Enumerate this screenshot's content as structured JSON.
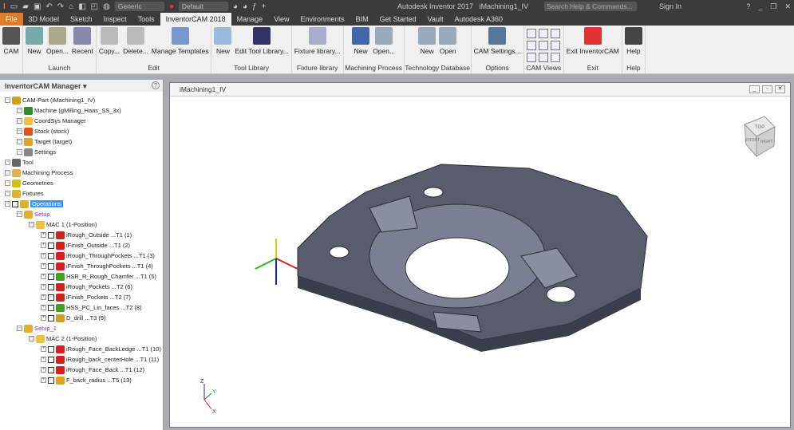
{
  "titlebar": {
    "app_title": "Autodesk Inventor 2017",
    "doc_title": "iMachining1_IV",
    "material": "Generic",
    "appearance": "Default",
    "search_placeholder": "Search Help & Commands...",
    "sign_in": "Sign In"
  },
  "tabs": [
    "File",
    "3D Model",
    "Sketch",
    "Inspect",
    "Tools",
    "InventorCAM 2018",
    "Manage",
    "View",
    "Environments",
    "BIM",
    "Get Started",
    "Vault",
    "Autodesk A360"
  ],
  "ribbon": {
    "panels": [
      {
        "label": "",
        "buttons": [
          "CAM"
        ]
      },
      {
        "label": "Launch",
        "buttons": [
          "New",
          "Open...",
          "Recent"
        ]
      },
      {
        "label": "Edit",
        "buttons": [
          "Copy...",
          "Delete...",
          "Manage Templates"
        ]
      },
      {
        "label": "Tool Library",
        "buttons": [
          "New",
          "Edit Tool Library..."
        ]
      },
      {
        "label": "Fixture library",
        "buttons": [
          "Fixture library..."
        ]
      },
      {
        "label": "Machining Process",
        "buttons": [
          "New",
          "Open..."
        ]
      },
      {
        "label": "Technology Database",
        "buttons": [
          "New",
          "Open"
        ]
      },
      {
        "label": "Options",
        "buttons": [
          "CAM Settings..."
        ]
      },
      {
        "label": "CAM Views",
        "buttons": []
      },
      {
        "label": "Exit",
        "buttons": [
          "Exit InventorCAM"
        ]
      },
      {
        "label": "Help",
        "buttons": [
          "Help"
        ]
      }
    ]
  },
  "manager": {
    "title": "InventorCAM Manager",
    "tree": [
      {
        "label": "CAM-Part (iMachining1_IV)",
        "level": 0,
        "color": "#d4a017"
      },
      {
        "label": "Machine (gMilling_Haas_SS_3x)",
        "level": 1,
        "color": "#2e8b2e"
      },
      {
        "label": "CoordSys Manager",
        "level": 1,
        "color": "#f0c040"
      },
      {
        "label": "Stock (stock)",
        "level": 1,
        "color": "#e05020"
      },
      {
        "label": "Target (target)",
        "level": 1,
        "color": "#e0a030"
      },
      {
        "label": "Settings",
        "level": 1,
        "color": "#888888"
      },
      {
        "label": "Tool",
        "level": 0,
        "color": "#666666"
      },
      {
        "label": "Machining Process",
        "level": 0,
        "color": "#e0b050"
      },
      {
        "label": "Geometries",
        "level": 0,
        "color": "#d0c020"
      },
      {
        "label": "Fixtures",
        "level": 0,
        "color": "#e0b030"
      },
      {
        "label": "Operations",
        "level": 0,
        "color": "#e0b030",
        "selected": true,
        "checkbox": true
      },
      {
        "label": "Setup",
        "level": 1,
        "color": "#e0b030",
        "purple": true
      },
      {
        "label": "MAC 1 (1-Position)",
        "level": 2,
        "color": "#f0c040"
      },
      {
        "label": "iRough_Outside ...T1 (1)",
        "level": 3,
        "color": "#d02020",
        "checkbox": true
      },
      {
        "label": "iFinish_Outside ...T1 (2)",
        "level": 3,
        "color": "#d02020",
        "checkbox": true
      },
      {
        "label": "iRough_ThroughPockets ...T1 (3)",
        "level": 3,
        "color": "#d02020",
        "checkbox": true
      },
      {
        "label": "iFinish_ThroughPockets ...T1 (4)",
        "level": 3,
        "color": "#d02020",
        "checkbox": true
      },
      {
        "label": "HSR_R_Rough_Chamfer ...T1 (5)",
        "level": 3,
        "color": "#40a020",
        "checkbox": true
      },
      {
        "label": "iRough_Pockets ...T2 (6)",
        "level": 3,
        "color": "#d02020",
        "checkbox": true
      },
      {
        "label": "iFinish_Pockets ...T2 (7)",
        "level": 3,
        "color": "#d02020",
        "checkbox": true
      },
      {
        "label": "HSS_PC_Lin_faces ...T2 (8)",
        "level": 3,
        "color": "#40a020",
        "checkbox": true
      },
      {
        "label": "D_drill ...T3 (9)",
        "level": 3,
        "color": "#d0a020",
        "checkbox": true
      },
      {
        "label": "Setup_1",
        "level": 1,
        "color": "#e0b030",
        "purple": true
      },
      {
        "label": "MAC 2 (1-Position)",
        "level": 2,
        "color": "#f0c040"
      },
      {
        "label": "iRough_Face_BackLedge ...T1 (10)",
        "level": 3,
        "color": "#d02020",
        "checkbox": true
      },
      {
        "label": "iRough_back_centerHole ...T1 (11)",
        "level": 3,
        "color": "#d02020",
        "checkbox": true
      },
      {
        "label": "iRough_Face_Back ...T1 (12)",
        "level": 3,
        "color": "#d02020",
        "checkbox": true
      },
      {
        "label": "F_back_radius ...T5 (13)",
        "level": 3,
        "color": "#e0a020",
        "checkbox": true
      }
    ]
  },
  "viewport": {
    "title": "iMachining1_IV",
    "viewcube": [
      "TOP",
      "FRONT",
      "RIGHT"
    ],
    "axes": {
      "x": "X",
      "y": "Y",
      "z": "Z"
    }
  }
}
